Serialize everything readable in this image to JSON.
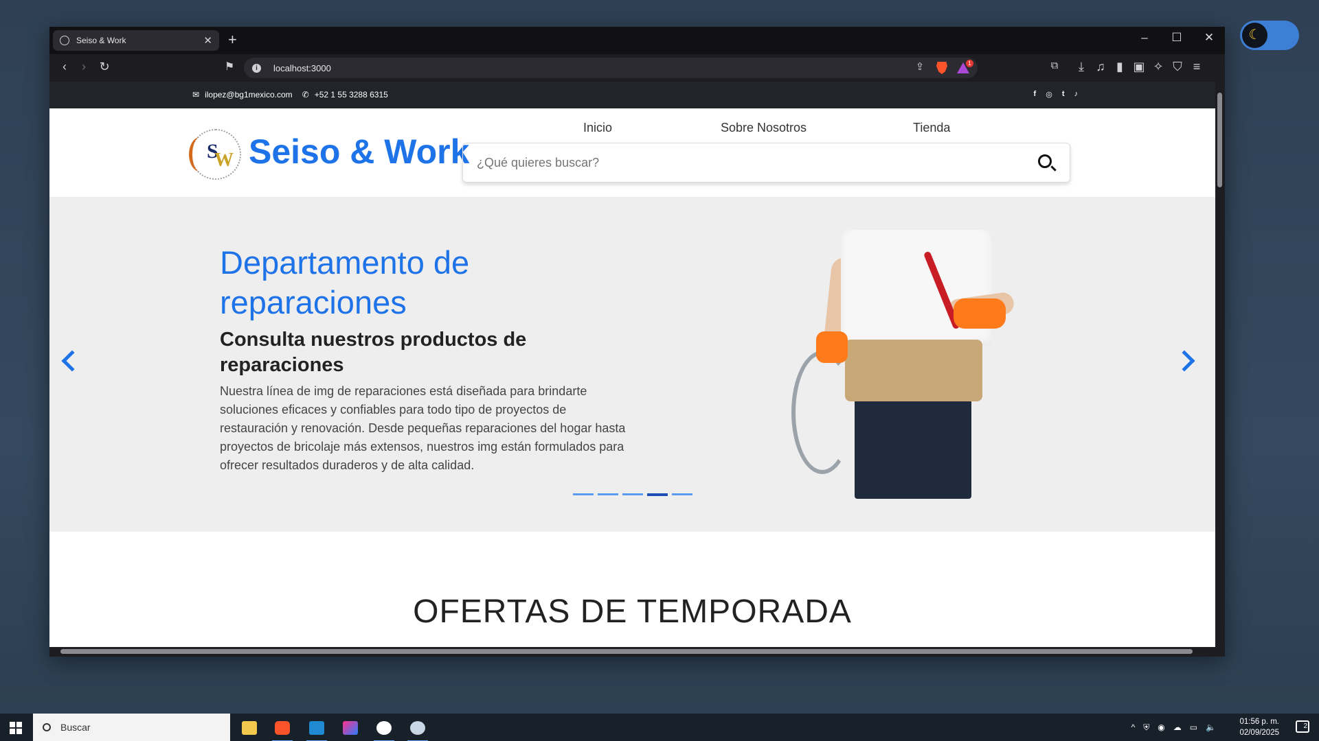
{
  "browser": {
    "tab_title": "Seiso & Work",
    "url": "localhost:3000",
    "reward_badge": "1"
  },
  "topbar": {
    "email": "ilopez@bg1mexico.com",
    "phone": "+52 1 55 3288 6315",
    "social": [
      "f",
      "◎",
      "t",
      "♪"
    ]
  },
  "header": {
    "brand": "Seiso & Work",
    "nav": [
      "Inicio",
      "Sobre Nosotros",
      "Tienda"
    ],
    "search_placeholder": "¿Qué quieres buscar?"
  },
  "hero": {
    "title": "Departamento de reparaciones",
    "subtitle": "Consulta nuestros productos de reparaciones",
    "description": "Nuestra línea de img de reparaciones está diseñada para brindarte soluciones eficaces y confiables para todo tipo de proyectos de restauración y renovación. Desde pequeñas reparaciones del hogar hasta proyectos de bricolaje más extensos, nuestros img están formulados para ofrecer resultados duraderos y de alta calidad.",
    "slides": 5,
    "active_slide": 4
  },
  "section": {
    "title": "OFERTAS DE TEMPORADA"
  },
  "taskbar": {
    "search_label": "Buscar",
    "time": "01:56 p. m.",
    "date": "02/09/2025",
    "notifications": "2"
  },
  "colors": {
    "accent": "#1e73e8",
    "topbar": "#212529",
    "hero_bg": "#eeeeee"
  },
  "icons": {
    "email": "envelope-icon",
    "phone": "phone-icon",
    "search": "magnifier-icon",
    "theme": "moon-icon"
  }
}
